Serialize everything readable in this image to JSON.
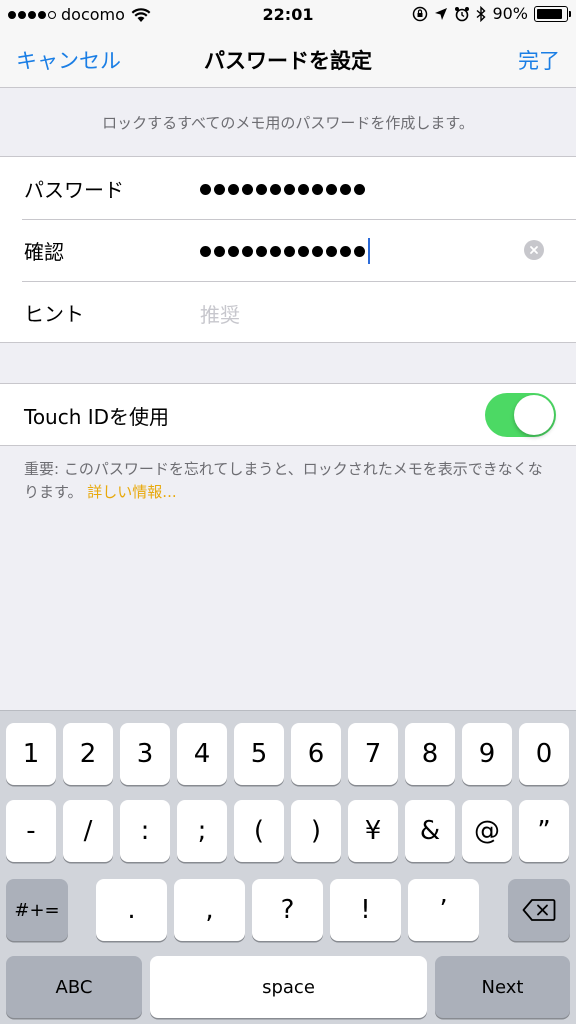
{
  "status_bar": {
    "carrier": "docomo",
    "time": "22:01",
    "battery_percent": "90%",
    "battery_level": 0.9
  },
  "nav": {
    "cancel_label": "キャンセル",
    "title": "パスワードを設定",
    "done_label": "完了"
  },
  "header_text": "ロックするすべてのメモ用のパスワードを作成します。",
  "form": {
    "password_label": "パスワード",
    "password_length": 12,
    "verify_label": "確認",
    "verify_length": 12,
    "hint_label": "ヒント",
    "hint_placeholder": "推奨"
  },
  "touch_id": {
    "label": "Touch IDを使用",
    "enabled": true
  },
  "footnote": {
    "text": "重要: このパスワードを忘れてしまうと、ロックされたメモを表示できなくなります。",
    "link": "詳しい情報..."
  },
  "keyboard": {
    "row1": [
      "1",
      "2",
      "3",
      "4",
      "5",
      "6",
      "7",
      "8",
      "9",
      "0"
    ],
    "row2": [
      "-",
      "/",
      ":",
      ";",
      "(",
      ")",
      "¥",
      "&",
      "@",
      "”"
    ],
    "symbols_key": "#+=",
    "row3": [
      ".",
      ",",
      "?",
      "!",
      "’"
    ],
    "abc_key": "ABC",
    "space_key": "space",
    "next_key": "Next"
  },
  "colors": {
    "accent": "#1a7ee5",
    "toggle_on": "#4cd964",
    "link": "#e8a90c"
  }
}
